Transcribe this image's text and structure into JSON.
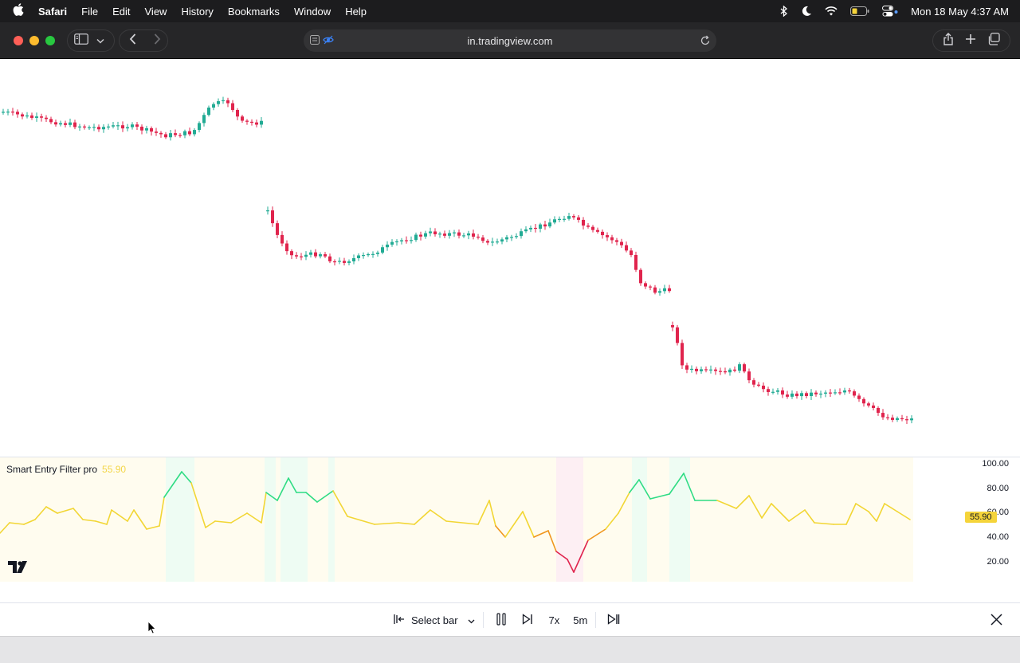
{
  "menubar": {
    "app_name": "Safari",
    "items": [
      "File",
      "Edit",
      "View",
      "History",
      "Bookmarks",
      "Window",
      "Help"
    ],
    "datetime": "Mon 18 May  4:37 AM"
  },
  "browser": {
    "url": "in.tradingview.com"
  },
  "indicator": {
    "name": "Smart Entry Filter pro",
    "value": "55.90",
    "axis_labels": [
      "100.00",
      "80.00",
      "60.00",
      "40.00",
      "20.00"
    ],
    "current_tag": "55.90"
  },
  "replay": {
    "select_bar_label": "Select bar",
    "speed_label": "7x",
    "interval_label": "5m"
  },
  "colors": {
    "up": "#22ab94",
    "down": "#e0244d",
    "indicator_value": "#f3d64a",
    "price_tag": "#f5d43a"
  }
}
